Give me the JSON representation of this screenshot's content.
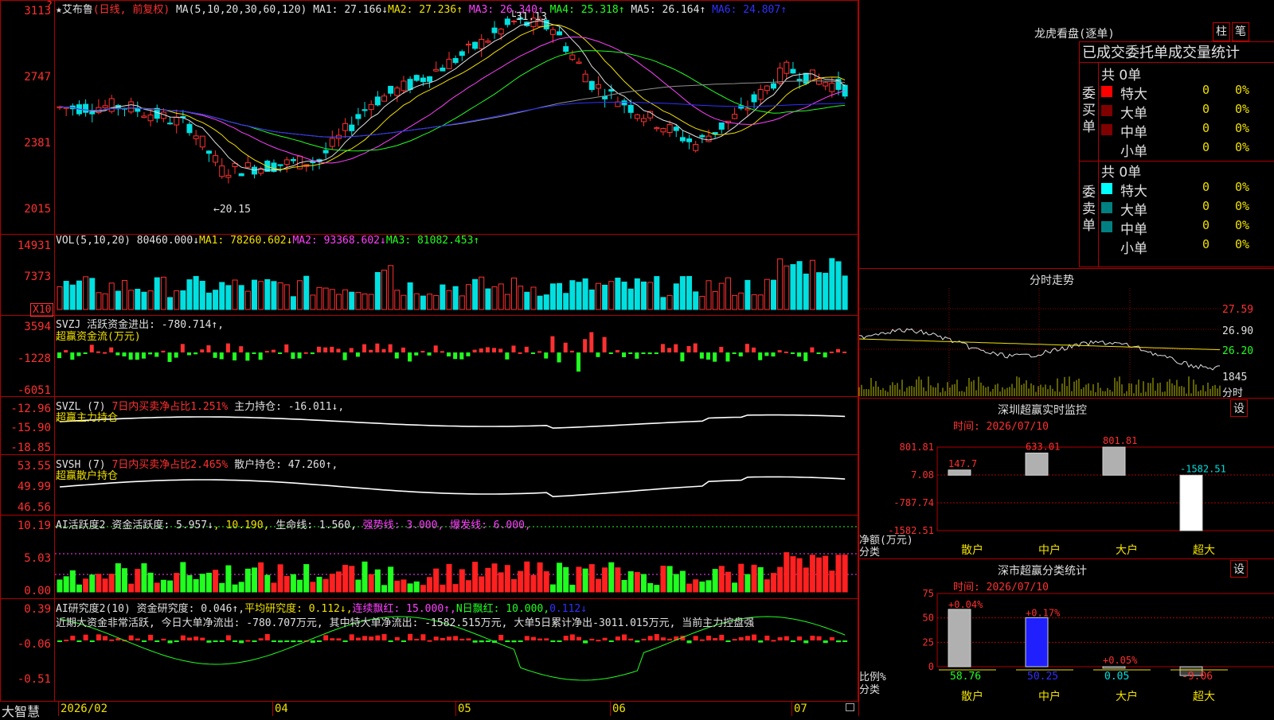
{
  "main": {
    "star": "★",
    "stock_name": "艾布鲁",
    "period": "(日线, 前复权)",
    "ma_params": "MA(5,10,20,30,60,120)",
    "ma1": "MA1: 27.166↓",
    "ma2": "MA2: 27.236↑",
    "ma3": "MA3: 26.340↑",
    "ma4": "MA4: 25.318↑",
    "ma5": "MA5: 26.164↑",
    "ma6": "MA6: 24.807↑",
    "y_ticks": [
      "3113",
      "2747",
      "2381",
      "2015"
    ],
    "high_label": "31.13",
    "low_label": "←20.15",
    "corner_mark": "?"
  },
  "vol": {
    "params": "VOL(5,10,20)",
    "value": "80460.000↓",
    "ma1": "MA1: 78260.602↓",
    "ma2": "MA2: 93368.602↓",
    "ma3": "MA3: 81082.453↑",
    "y_ticks": [
      "14931",
      "7373"
    ],
    "unit": "X10"
  },
  "svzj": {
    "line1": "SVZJ  活跃资金进出: -780.714↑,",
    "line2": "超赢资金流(万元)",
    "y_ticks": [
      "3594",
      "-1228",
      "-6051"
    ]
  },
  "svzl": {
    "name": "SVZL (7)",
    "ratio": "7日内买卖净占比1.251%",
    "hold": "主力持仓: -16.011↓,",
    "line2": "超赢主力持仓",
    "y_ticks": [
      "-12.96",
      "-15.90",
      "-18.85"
    ]
  },
  "svsh": {
    "name": "SVSH (7)",
    "ratio": "7日内买卖净占比2.465%",
    "hold": "散户持仓: 47.260↑,",
    "line2": "超赢散户持仓",
    "y_ticks": [
      "53.55",
      "49.99",
      "46.56"
    ]
  },
  "ai1": {
    "name": "AI活跃度2",
    "active": "资金活跃度: 5.957↓",
    "v2": ", 10.190,",
    "life": "生命线: 1.560,",
    "strong": "强势线: 3.000,",
    "burst": "爆发线: 6.000,",
    "y_ticks": [
      "10.19",
      "5.03",
      "0.00"
    ]
  },
  "ai2": {
    "name": "AI研究度2(10)",
    "research": "资金研究度: 0.046↑,",
    "avg": "平均研究度: 0.112↓,",
    "cont": "连续飘红: 15.000↑,",
    "nday": "N日飘红: 10.000,",
    "v5": "0.112↓",
    "desc": "近期大资金非常活跃, 今日大单净流出: -780.707万元, 其中特大单净流出: -1582.515万元, 大单5日累计净出-3011.015万元, 当前主力控盘强",
    "y_ticks": [
      "0.39",
      "-0.06",
      "-0.51"
    ]
  },
  "xaxis": {
    "brand": "大智慧",
    "labels": [
      "2026/02",
      "04",
      "05",
      "06",
      "07"
    ]
  },
  "lhb": {
    "title": "龙虎看盘(逐单)",
    "btn1": "柱",
    "btn2": "笔",
    "tabs": "已成交委托单成交量统计",
    "buy_label": "委买单",
    "sell_label": "委卖单",
    "buy_total": "共 0单",
    "sell_total": "共 0单",
    "buy_rows": [
      {
        "label": "特大",
        "count": "0",
        "pct": "0%",
        "color": "#ff0000"
      },
      {
        "label": "大单",
        "count": "0",
        "pct": "0%",
        "color": "#800000"
      },
      {
        "label": "中单",
        "count": "0",
        "pct": "0%",
        "color": "#800000"
      },
      {
        "label": "小单",
        "count": "0",
        "pct": "0%",
        "color": "#000000"
      }
    ],
    "sell_rows": [
      {
        "label": "特大",
        "count": "0",
        "pct": "0%",
        "color": "#00ffff"
      },
      {
        "label": "大单",
        "count": "0",
        "pct": "0%",
        "color": "#008080"
      },
      {
        "label": "中单",
        "count": "0",
        "pct": "0%",
        "color": "#008080"
      },
      {
        "label": "小单",
        "count": "0",
        "pct": "0%",
        "color": "#000000"
      }
    ]
  },
  "fenshi": {
    "title": "分时走势",
    "y_ticks": [
      "27.59",
      "26.90",
      "26.20"
    ],
    "vol_tick": "1845",
    "vol_unit": "分时"
  },
  "sz_monitor": {
    "title": "深圳超赢实时监控",
    "btn": "设",
    "time": "时间: 2026/07/10",
    "y_ticks": [
      "801.81",
      "7.08",
      "-787.74",
      "-1582.51"
    ],
    "ylabel": "净额(万元)",
    "xlabel_left": "分类",
    "chart_data": {
      "type": "bar",
      "categories": [
        "散户",
        "中户",
        "大户",
        "超大"
      ],
      "values": [
        147.7,
        633.01,
        801.81,
        -1582.51
      ],
      "value_labels": [
        "147.7",
        "633.01",
        "801.81",
        "-1582.51"
      ],
      "ylim": [
        -1582.51,
        801.81
      ],
      "title": "深圳超赢实时监控",
      "ylabel": "净额(万元)"
    }
  },
  "sz_class": {
    "title": "深市超赢分类统计",
    "btn": "设",
    "time": "时间: 2026/07/10",
    "y_ticks": [
      "75",
      "50",
      "25",
      "0"
    ],
    "ylabel": "比例%",
    "xlabel_left": "分类",
    "chart_data": {
      "type": "bar",
      "categories": [
        "散户",
        "中户",
        "大户",
        "超大"
      ],
      "values": [
        58.76,
        50.25,
        0.05,
        -9.06
      ],
      "top_labels": [
        "+0.04%",
        "+0.17%",
        "+0.05%",
        ""
      ],
      "bottom_labels": [
        "58.76",
        "50.25",
        "0.05",
        "-9.06"
      ],
      "ylim": [
        0,
        75
      ],
      "title": "深市超赢分类统计",
      "ylabel": "比例%"
    }
  }
}
